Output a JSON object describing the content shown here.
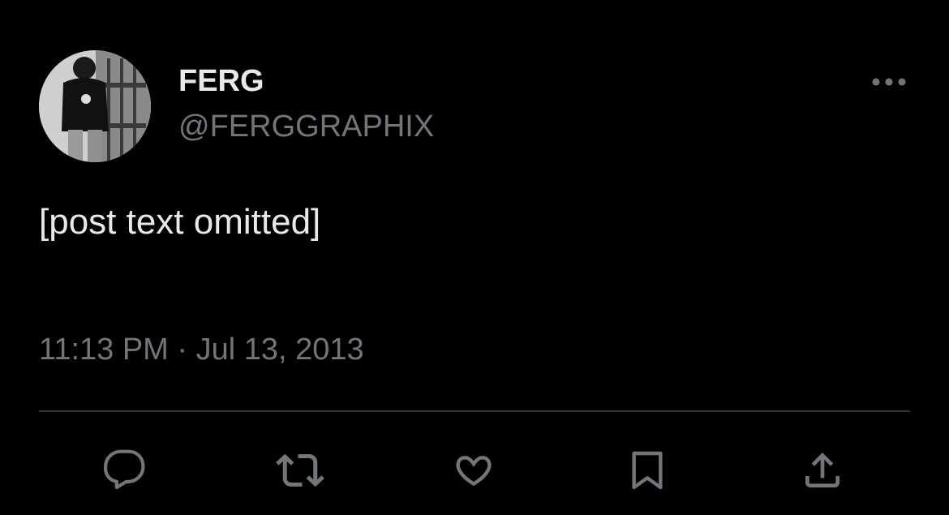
{
  "colors": {
    "background": "#000000",
    "primary_text": "#e7e9ea",
    "secondary_text": "#71767b",
    "divider": "#2f3336"
  },
  "author": {
    "display_name": "FERG",
    "handle": "@FERGGRAPHIX",
    "avatar_icon": "user-photo"
  },
  "post": {
    "text": "[post text omitted]",
    "timestamp": "11:13 PM · Jul 13, 2013"
  },
  "menu": {
    "icon": "more-horizontal-icon"
  },
  "actions": [
    {
      "name": "reply",
      "icon": "reply-icon"
    },
    {
      "name": "repost",
      "icon": "repost-icon"
    },
    {
      "name": "like",
      "icon": "heart-icon"
    },
    {
      "name": "bookmark",
      "icon": "bookmark-icon"
    },
    {
      "name": "share",
      "icon": "share-icon"
    }
  ]
}
